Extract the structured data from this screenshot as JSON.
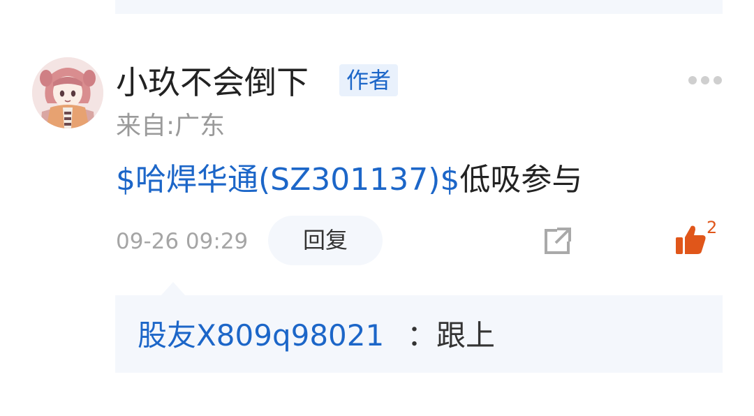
{
  "post": {
    "author": {
      "name": "小玖不会倒下",
      "badge": "作者",
      "location": "来自:广东",
      "avatar_icon": "anime-avatar"
    },
    "content": {
      "stock_link": "$哈焊华通(SZ301137)$",
      "text": "低吸参与"
    },
    "time": "09-26 09:29",
    "reply_label": "回复",
    "share_icon": "share-icon",
    "more_icon": "more-icon",
    "like": {
      "icon": "thumbs-up-icon",
      "count": "2",
      "color": "#e0561a"
    }
  },
  "replies": [
    {
      "user": "股友X809q98021",
      "text": "：跟上"
    }
  ],
  "colors": {
    "link": "#1c66c8",
    "panel_bg": "#f4f7fc",
    "muted": "#a5a5a5",
    "text": "#222222"
  }
}
